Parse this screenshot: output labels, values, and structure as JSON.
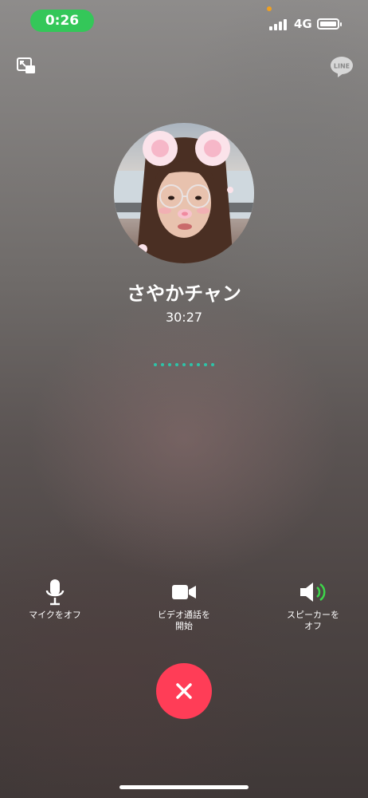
{
  "status_bar": {
    "time": "0:26",
    "network": "4G",
    "battery_level": 0.9
  },
  "call": {
    "contact_name": "さやかチャン",
    "duration": "30:27"
  },
  "controls": {
    "mute": {
      "label": "マイクをオフ",
      "icon": "microphone-icon"
    },
    "video": {
      "label_line1": "ビデオ通話を",
      "label_line2": "開始",
      "icon": "video-camera-icon"
    },
    "speaker": {
      "label_line1": "スピーカーを",
      "label_line2": "オフ",
      "icon": "speaker-icon"
    }
  },
  "end_call": {
    "icon": "close-icon"
  },
  "top_bar": {
    "minimize_icon": "minimize-window-icon",
    "line_icon": "line-logo-icon",
    "line_text": "LINE"
  },
  "colors": {
    "time_pill": "#34c759",
    "end_call": "#ff3d57",
    "speaker_active": "#3dd64a",
    "dots": "#2ec4a8"
  }
}
